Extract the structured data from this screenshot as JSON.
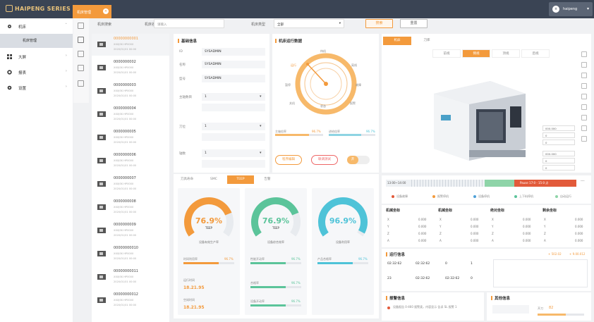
{
  "app": {
    "logo_text": "HAIPENG SERIES",
    "tab_label": "机床管理",
    "user": {
      "avatar": "H",
      "name": "haipeng"
    }
  },
  "sidebar": {
    "items": [
      {
        "label": "机床"
      },
      {
        "label": "机床管理"
      },
      {
        "label": "大屏"
      },
      {
        "label": "报表"
      },
      {
        "label": "设置"
      }
    ]
  },
  "filter": {
    "label1": "机床搜索",
    "label2": "机床名称",
    "input2_placeholder": "请输入",
    "label3": "机床类型",
    "select3_value": "全部",
    "btn_search": "搜索",
    "btn_reset": "重置"
  },
  "machines": [
    {
      "code": "00000000001",
      "s1": "XXXJSK HP0000",
      "s2": "2020/01/01 00:00"
    },
    {
      "code": "0000000002",
      "s1": "XXXJSK HP0000",
      "s2": "2020/01/01 00:00"
    },
    {
      "code": "0000000003",
      "s1": "XXXJSK HP0000",
      "s2": "2020/01/01 00:00"
    },
    {
      "code": "0000000004",
      "s1": "XXXJSK HP0000",
      "s2": "2020/01/01 00:00"
    },
    {
      "code": "0000000005",
      "s1": "XXXJSK HP0000",
      "s2": "2020/01/01 00:00"
    },
    {
      "code": "0000000006",
      "s1": "XXXJSK HP0000",
      "s2": "2020/01/01 00:00"
    },
    {
      "code": "0000000007",
      "s1": "XXXJSK HP0000",
      "s2": "2020/01/01 00:00"
    },
    {
      "code": "0000000008",
      "s1": "XXXJSK HP0000",
      "s2": "2020/01/01 00:00"
    },
    {
      "code": "0000000009",
      "s1": "XXXJSK HP0000",
      "s2": "2020/01/01 00:00"
    },
    {
      "code": "00000000010",
      "s1": "XXXJSK HP0000",
      "s2": "2020/01/01 00:00"
    },
    {
      "code": "00000000011",
      "s1": "XXXJSK HP0000",
      "s2": "2020/01/01 00:00"
    },
    {
      "code": "00000000012",
      "s1": "XXXJSK HP0000",
      "s2": "2020/01/01 00:00"
    }
  ],
  "basic": {
    "title": "基础信息",
    "rows": [
      {
        "k": "ID",
        "v": "SYSADMIN"
      },
      {
        "k": "名称",
        "v": "SYSADMIN"
      },
      {
        "k": "型号",
        "v": "SYSADMIN"
      },
      {
        "k": "主轴数目",
        "v": "1"
      },
      {
        "k": "刀位",
        "v": "1"
      },
      {
        "k": "轴数",
        "v": "1"
      }
    ]
  },
  "runtime": {
    "title": "机床运行数据",
    "labels": [
      "运行",
      "暂停",
      "待机",
      "离线",
      "故障",
      "报警",
      "关机"
    ],
    "center": "状态",
    "r1": "主轴倍率",
    "v1": "96.7%",
    "r2": "进给倍率",
    "v2": "96.7%",
    "btn1": "程序编辑",
    "btn2": "联调测试",
    "toggle": "开"
  },
  "tabs": {
    "items": [
      "刀具寿命",
      "SMC",
      "TEEP",
      "告警"
    ],
    "active": 2
  },
  "gauges": [
    {
      "value": "76.9%",
      "caption": "TEEP",
      "label": "设备有效生产率",
      "color": "#f39a3c",
      "frac": 0.769
    },
    {
      "value": "76.9%",
      "caption": "TEEP",
      "label": "设备综合效率",
      "color": "#5bc49a",
      "frac": 0.769
    },
    {
      "value": "96.9%",
      "caption": "",
      "label": "设备利用率",
      "color": "#4ec3d8",
      "frac": 0.969
    }
  ],
  "gstats": [
    {
      "r1": "时间利用率",
      "v1": "96.7%",
      "t1": "运行时间",
      "n1": "18.21.95",
      "t2": "空闲时间",
      "n2": "18.21.95"
    },
    {
      "r1": "性能开动率",
      "v1": "96.7%",
      "r2": "合格率",
      "v2": "96.7%",
      "r3": "设备开动率",
      "v3": "96.7%"
    },
    {
      "r1": "产品合格率",
      "v1": "96.7%"
    }
  ],
  "viewer": {
    "tabs": [
      "机床",
      "刀库"
    ],
    "subtabs": [
      "前视",
      "侧视",
      "顶视",
      "后视"
    ],
    "active_sub": 1,
    "selects": [
      "000.000",
      "0",
      "0",
      "000.000",
      "0",
      "0"
    ]
  },
  "timeline": {
    "start": "13:00~14:00",
    "end_label": "Pause 17:0 - 15:0 点",
    "legend": [
      "设备故障",
      "报警停机",
      "设备停机",
      "上下料停机",
      "自动运行"
    ]
  },
  "grids": [
    {
      "title": "机械坐标",
      "rows": [
        [
          "X",
          "0.000"
        ],
        [
          "Y",
          "0.000"
        ],
        [
          "Z",
          "0.000"
        ],
        [
          "A",
          "0.000"
        ]
      ]
    },
    {
      "title": "机械坐标",
      "rows": [
        [
          "X",
          "0.000"
        ],
        [
          "Y",
          "0.000"
        ],
        [
          "Z",
          "0.000"
        ],
        [
          "A",
          "0.000"
        ]
      ]
    },
    {
      "title": "绝对坐标",
      "rows": [
        [
          "X",
          "0.000"
        ],
        [
          "Y",
          "0.000"
        ],
        [
          "Z",
          "0.000"
        ],
        [
          "A",
          "0.000"
        ]
      ]
    },
    {
      "title": "剩余坐标",
      "rows": [
        [
          "X",
          "0.000"
        ],
        [
          "Y",
          "0.000"
        ],
        [
          "Z",
          "0.000"
        ],
        [
          "A",
          "0.000"
        ]
      ]
    }
  ],
  "runinfo": {
    "title": "运行信息",
    "a1": "+ 502.02",
    "a2": "+ 9.00.012",
    "v1": "02:32:62",
    "v2": "02:32:62",
    "v3": "0",
    "v4": "1",
    "v5": "23",
    "v6": "02:32:62",
    "v7": "02:32:62",
    "v8": "0"
  },
  "alarm": {
    "title": "报警信息",
    "text": "设备报告 0-460 报警类，内容显示 告诉 SL 报警 1"
  },
  "other": {
    "title": "其他信息",
    "label": "开刀",
    "value": "82"
  }
}
